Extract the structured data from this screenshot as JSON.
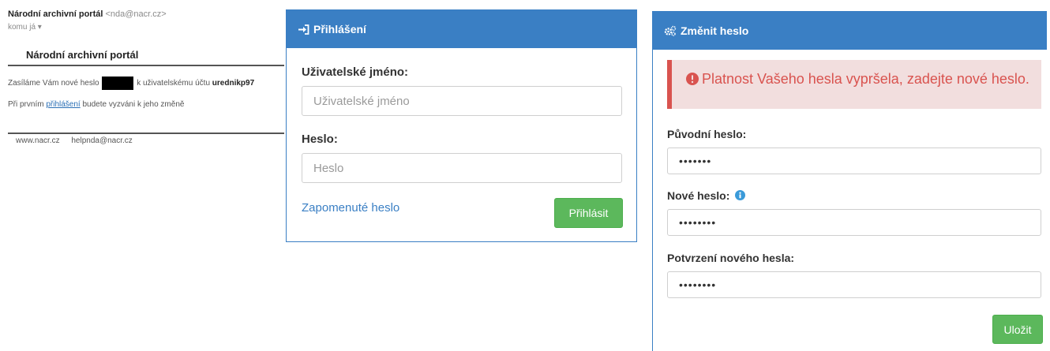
{
  "email": {
    "sender_name": "Národní archivní portál",
    "sender_addr": "<nda@nacr.cz>",
    "to": "komu já ▾",
    "title": "Národní archivní portál",
    "line1_before": "Zasíláme Vám nové heslo",
    "line1_after": "k uživatelskému účtu",
    "username": "urednikp97",
    "line2_before": "Při prvním",
    "line2_link": "přihlášení",
    "line2_after": "budete vyzváni k jeho změně",
    "footer_web": "www.nacr.cz",
    "footer_mail": "helpnda@nacr.cz"
  },
  "login": {
    "title": "Přihlášení",
    "username_label": "Uživatelské jméno:",
    "username_placeholder": "Uživatelské jméno",
    "password_label": "Heslo:",
    "password_placeholder": "Heslo",
    "forgot": "Zapomenuté heslo",
    "submit": "Přihlásit"
  },
  "change": {
    "title": "Změnit heslo",
    "alert": "Platnost Vašeho hesla vypršela, zadejte nové heslo.",
    "old_label": "Původní heslo:",
    "old_value": "•••••••",
    "new_label": "Nové heslo:",
    "new_value": "••••••••",
    "confirm_label": "Potvrzení nového hesla:",
    "confirm_value": "••••••••",
    "save": "Uložit"
  },
  "colors": {
    "primary": "#3a7fc4",
    "success": "#5cb85c",
    "danger": "#d9534f",
    "danger_bg": "#f2dede"
  },
  "icons": {
    "login": "sign-in-icon",
    "change": "gears-icon",
    "alert": "exclamation-circle-icon",
    "info": "info-circle-icon"
  }
}
